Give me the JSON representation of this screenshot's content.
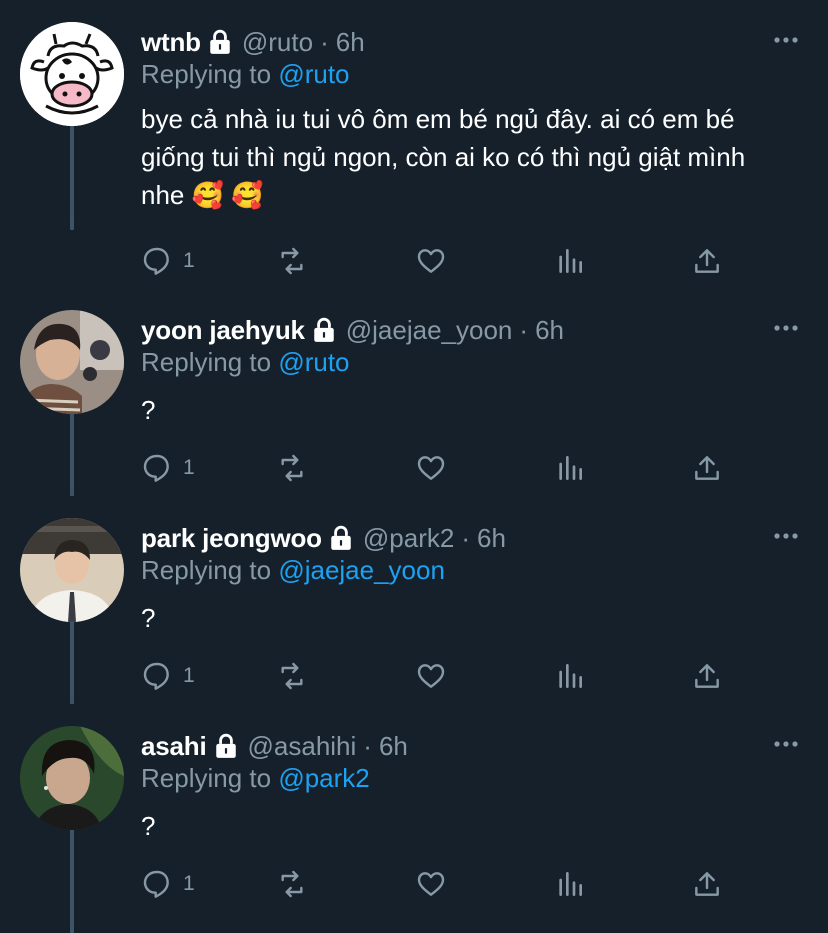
{
  "tweets": [
    {
      "name": "wtnb",
      "handle": "@ruto",
      "separator": "·",
      "time": "6h",
      "replying_prefix": "Replying to",
      "replying_to": "@ruto",
      "text": "bye cả nhà iu tui vô ôm em bé ngủ đây. ai có em bé giống tui thì ngủ ngon, còn ai ko có thì ngủ giật mình nhe 🥰 🥰",
      "reply_count": "1",
      "avatar": "cow-drawing-avatar"
    },
    {
      "name": "yoon jaehyuk",
      "handle": "@jaejae_yoon",
      "separator": "·",
      "time": "6h",
      "replying_prefix": "Replying to",
      "replying_to": "@ruto",
      "text": "?",
      "reply_count": "1",
      "avatar": "photo-avatar"
    },
    {
      "name": "park jeongwoo",
      "handle": "@park2",
      "separator": "·",
      "time": "6h",
      "replying_prefix": "Replying to",
      "replying_to": "@jaejae_yoon",
      "text": "?",
      "reply_count": "1",
      "avatar": "photo-avatar"
    },
    {
      "name": "asahi",
      "handle": "@asahihi",
      "separator": "·",
      "time": "6h",
      "replying_prefix": "Replying to",
      "replying_to": "@park2",
      "text": "?",
      "reply_count": "1",
      "avatar": "photo-avatar"
    }
  ],
  "icons": {
    "lock": "lock-icon",
    "more": "more-icon",
    "reply": "reply-icon",
    "retweet": "retweet-icon",
    "like": "heart-icon",
    "stats": "analytics-icon",
    "share": "share-icon"
  },
  "colors": {
    "background": "#15202b",
    "text": "#ffffff",
    "muted": "#8899a6",
    "accent": "#1da1f2",
    "thread_line": "#3d5466"
  }
}
